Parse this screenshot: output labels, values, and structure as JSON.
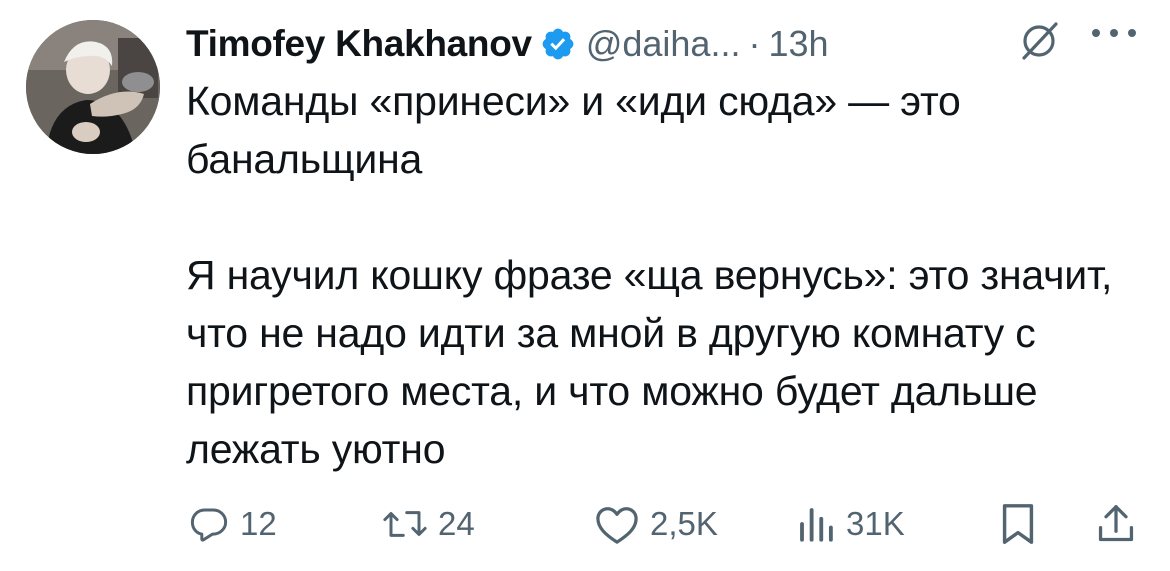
{
  "tweet": {
    "author_name": "Timofey Khakhanov",
    "handle": "@daiha...",
    "separator": "·",
    "time": "13h",
    "paragraphs": [
      "Команды «принеси» и «иди сюда» — это банальщина",
      "Я научил кошку фразе «ща вернусь»: это значит, что не надо идти за мной в другую комнату с пригретого места, и что можно будет дальше лежать уютно"
    ]
  },
  "actions": {
    "replies": "12",
    "reposts": "24",
    "likes": "2,5K",
    "views": "31K"
  },
  "icons": {
    "verified": "verified-badge-icon",
    "grok": "grok-icon",
    "more": "more-icon",
    "reply": "reply-icon",
    "repost": "repost-icon",
    "like": "like-icon",
    "views": "views-icon",
    "bookmark": "bookmark-icon",
    "share": "share-icon"
  },
  "colors": {
    "text": "#0f1419",
    "secondary": "#536471",
    "verified": "#1d9bf0"
  }
}
